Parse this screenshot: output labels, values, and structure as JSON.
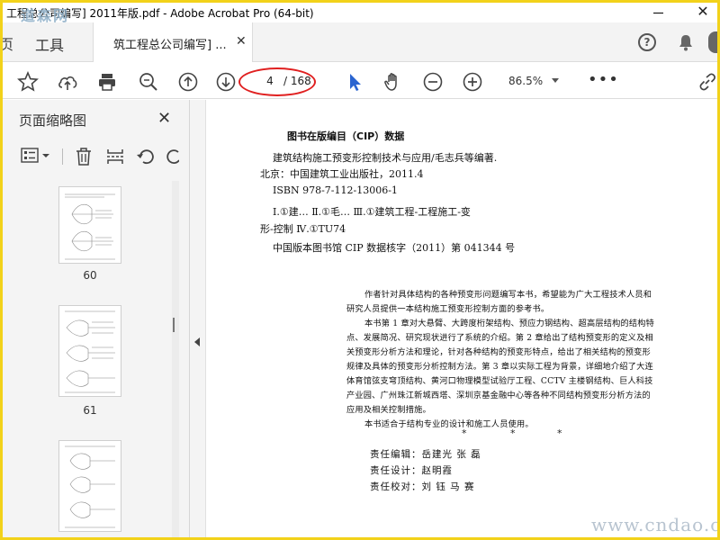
{
  "window": {
    "title": "工程总公司编写] 2011年版.pdf - Adobe Acrobat Pro (64-bit)",
    "close_glyph": "✕"
  },
  "tabs": {
    "home_partial": "页",
    "tools": "工具",
    "document": "筑工程总公司编写] ...",
    "document_close": "✕"
  },
  "toolbar": {
    "page_current": "4",
    "page_total": "/ 168",
    "zoom": "86.5%",
    "more": "•••",
    "icons": [
      "star-icon",
      "cloud-upload-icon",
      "print-icon",
      "zoom-search-icon",
      "page-up-icon",
      "page-down-icon",
      "select-arrow-icon",
      "hand-icon",
      "zoom-out-icon",
      "zoom-in-icon",
      "link-icon"
    ],
    "accent": "#2a64d0"
  },
  "sidebar": {
    "title": "页面缩略图",
    "close": "✕",
    "thumbnails": [
      {
        "page": "60"
      },
      {
        "page": "61"
      },
      {
        "page": ""
      }
    ]
  },
  "document": {
    "cip_heading": "图书在版编目（CIP）数据",
    "cip_lines": [
      "建筑结构施工预变形控制技术与应用/毛志兵等编著.",
      "北京：中国建筑工业出版社，2011.4",
      "ISBN 978-7-112-13006-1",
      "Ⅰ.①建…  Ⅱ.①毛…  Ⅲ.①建筑工程-工程施工-变",
      "形-控制  Ⅳ.①TU74",
      "中国版本图书馆 CIP 数据核字（2011）第 041344 号"
    ],
    "summary_lines": [
      "作者针对具体结构的各种预变形问题编写本书，希望能为广大工程技术人员和",
      "研究人员提供一本结构施工预变形控制方面的参考书。",
      "本书第 1 章对大悬臂、大跨度桁架结构、预应力钢结构、超高层结构的结构特",
      "点、发展简况、研究现状进行了系统的介绍。第 2 章给出了结构预变形的定义及相",
      "关预变形分析方法和理论，针对各种结构的预变形特点，给出了相关结构的预变形",
      "规律及具体的预变形分析控制方法。第 3 章以实际工程为背景，详细地介绍了大连",
      "体育馆弦支穹顶结构、黄河口物理模型试验厅工程、CCTV 主楼钢结构、巨人科技",
      "产业园、广州珠江新城西塔、深圳京基金融中心等各种不同结构预变形分析方法的",
      "应用及相关控制措施。",
      "本书适合于结构专业的设计和施工人员使用。"
    ],
    "stars": [
      "*",
      "*",
      "*"
    ],
    "credits": [
      "责任编辑：岳建光   张   磊",
      "责任设计：赵明霞",
      "责任校对：刘   钰   马   赛"
    ]
  },
  "watermarks": {
    "top_left": "道森网",
    "bottom_right": "www.cndao.com"
  }
}
